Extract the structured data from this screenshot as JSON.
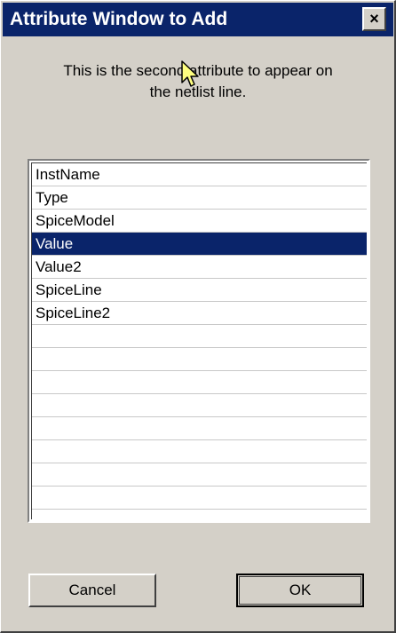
{
  "dialog": {
    "title": "Attribute Window to Add",
    "close_label": "×",
    "message_line1": "This is the second attribute to appear on",
    "message_line2": "the netlist line."
  },
  "list": {
    "items": [
      "InstName",
      "Type",
      "SpiceModel",
      "Value",
      "Value2",
      "SpiceLine",
      "SpiceLine2"
    ],
    "selected": "Value",
    "empty_rows": 8
  },
  "buttons": {
    "cancel_label": "Cancel",
    "ok_label": "OK"
  },
  "colors": {
    "titlebar": "#0a246a",
    "selection": "#0a246a",
    "face": "#d4d0c8"
  }
}
